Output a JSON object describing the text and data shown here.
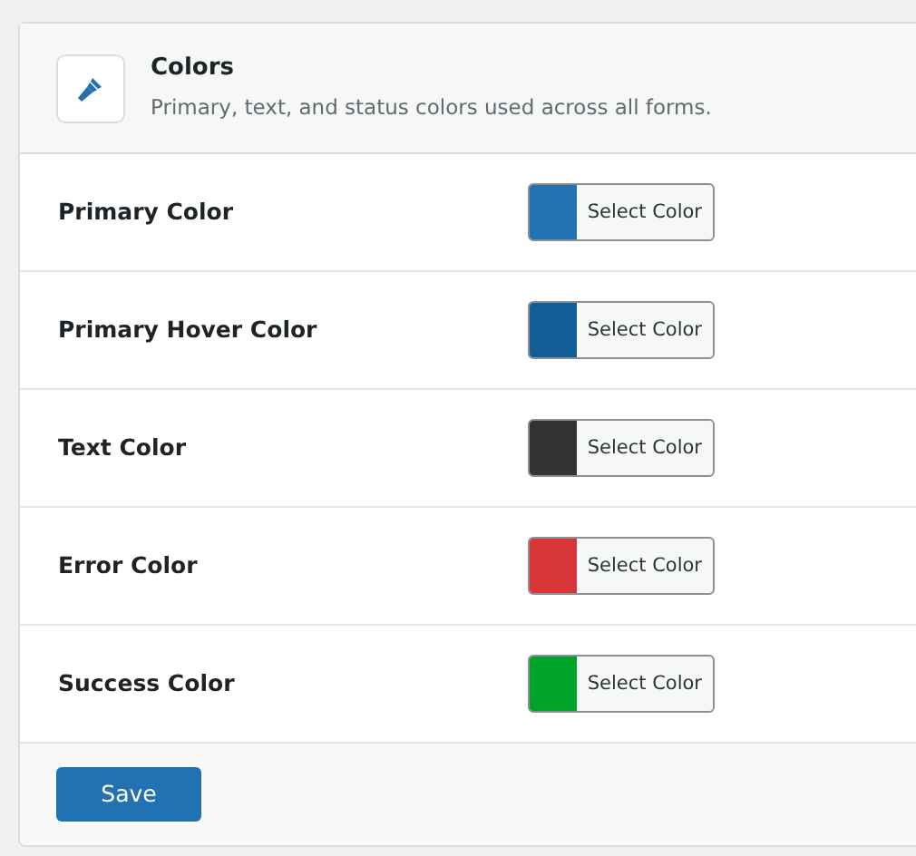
{
  "section": {
    "title": "Colors",
    "description": "Primary, text, and status colors used across all forms."
  },
  "fields": [
    {
      "label": "Primary Color",
      "button": "Select Color",
      "color": "#2271b1"
    },
    {
      "label": "Primary Hover Color",
      "button": "Select Color",
      "color": "#135e96"
    },
    {
      "label": "Text Color",
      "button": "Select Color",
      "color": "#333333"
    },
    {
      "label": "Error Color",
      "button": "Select Color",
      "color": "#d63638"
    },
    {
      "label": "Success Color",
      "button": "Select Color",
      "color": "#00a32a"
    }
  ],
  "save_button": "Save"
}
